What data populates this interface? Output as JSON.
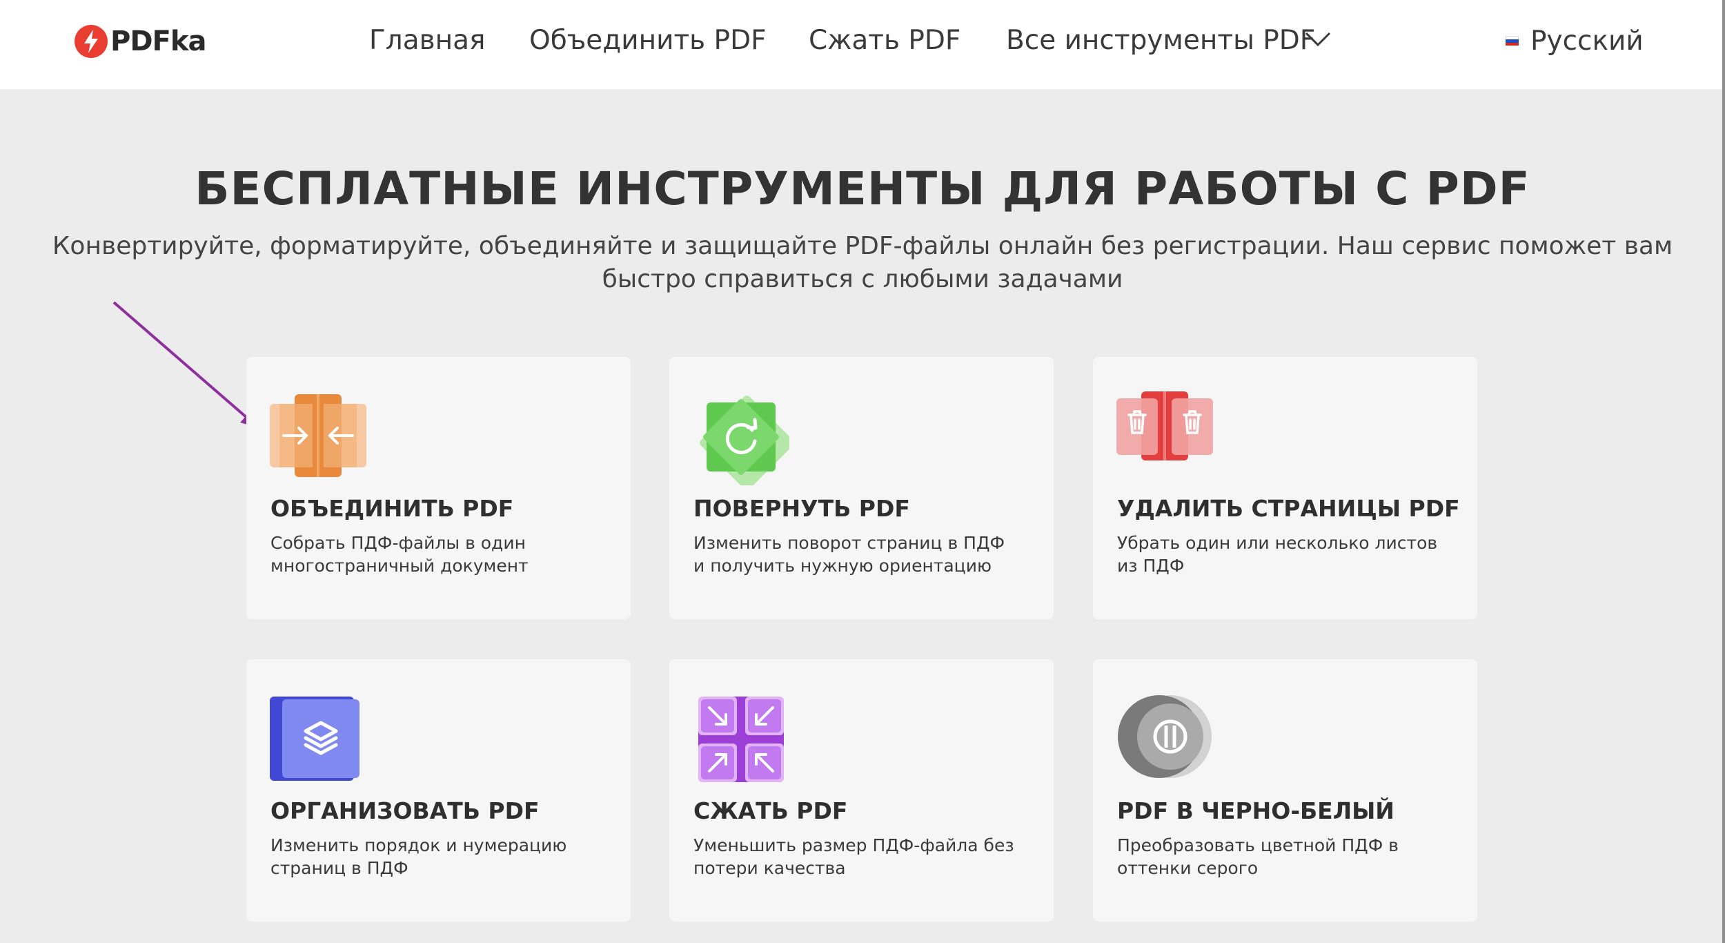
{
  "header": {
    "logo_text": "PDFka",
    "nav": [
      "Главная",
      "Объединить PDF",
      "Сжать PDF",
      "Все инструменты PDF"
    ],
    "language": "Русский"
  },
  "hero": {
    "title": "БЕСПЛАТНЫЕ ИНСТРУМЕНТЫ ДЛЯ РАБОТЫ С PDF",
    "subtitle": "Конвертируйте, форматируйте, объединяйте и защищайте PDF-файлы онлайн без регистрации. Наш сервис поможет вам быстро справиться с любыми задачами"
  },
  "tools": [
    {
      "title": "ОБЪЕДИНИТЬ PDF",
      "desc": "Собрать ПДФ-файлы в один многостраничный документ",
      "icon": "merge-icon",
      "color": "#e8893b"
    },
    {
      "title": "ПОВЕРНУТЬ PDF",
      "desc": "Изменить поворот страниц в ПДФ и получить нужную ориентацию",
      "icon": "rotate-icon",
      "color": "#5ec94e"
    },
    {
      "title": "УДАЛИТЬ СТРАНИЦЫ PDF",
      "desc": "Убрать один или несколько листов из ПДФ",
      "icon": "delete-pages-icon",
      "color": "#e33d3d"
    },
    {
      "title": "ОРГАНИЗОВАТЬ PDF",
      "desc": "Изменить порядок и нумерацию страниц в ПДФ",
      "icon": "organize-icon",
      "color": "#5a63e6"
    },
    {
      "title": "СЖАТЬ PDF",
      "desc": "Уменьшить размер ПДФ-файла без потери качества",
      "icon": "compress-icon",
      "color": "#b85de8"
    },
    {
      "title": "PDF В ЧЕРНО-БЕЛЫЙ",
      "desc": "Преобразовать цветной ПДФ в оттенки серого",
      "icon": "grayscale-icon",
      "color": "#8a8a8a"
    }
  ],
  "colors": {
    "background": "#ececec",
    "card": "#f6f6f6",
    "annotation_arrow": "#8e2f9e",
    "logo_red": "#ea3d32"
  }
}
